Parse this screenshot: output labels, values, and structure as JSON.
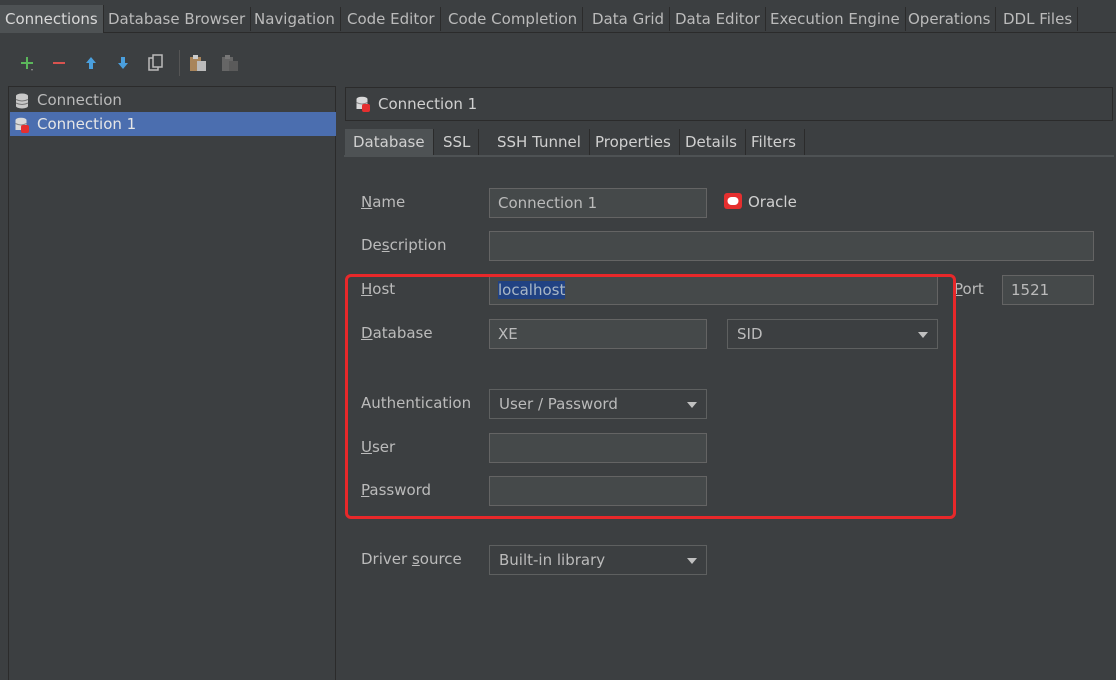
{
  "top_tabs": [
    {
      "label": "Connections",
      "active": true
    },
    {
      "label": "Database Browser"
    },
    {
      "label": "Navigation"
    },
    {
      "label": "Code Editor"
    },
    {
      "label": "Code Completion"
    },
    {
      "label": "Data Grid"
    },
    {
      "label": "Data Editor"
    },
    {
      "label": "Execution Engine"
    },
    {
      "label": "Operations"
    },
    {
      "label": "DDL Files"
    }
  ],
  "toolbar": {
    "icons": [
      "add-icon",
      "remove-icon",
      "move-up-icon",
      "move-down-icon",
      "copy-icon",
      "paste-icon",
      "paste-disabled-icon"
    ]
  },
  "tree": {
    "items": [
      {
        "label": "Connection",
        "icon": "database-icon"
      },
      {
        "label": "Connection 1",
        "icon": "oracle-connection-icon",
        "selected": true
      }
    ]
  },
  "panel": {
    "title": "Connection 1",
    "tabs": [
      "Database",
      "SSL",
      "SSH Tunnel",
      "Properties",
      "Details",
      "Filters"
    ],
    "active_tab": "Database"
  },
  "form": {
    "name_label_u": "N",
    "name_label_rest": "ame",
    "name_value": "Connection 1",
    "db_type": "Oracle",
    "description_label_a": "De",
    "description_label_u": "s",
    "description_label_b": "cription",
    "description_value": "",
    "host_label_u": "H",
    "host_label_rest": "ost",
    "host_value": "localhost",
    "port_label_u": "P",
    "port_label_rest": "ort",
    "port_value": "1521",
    "database_label_u": "D",
    "database_label_rest": "atabase",
    "database_value": "XE",
    "database_type": "SID",
    "auth_label": "Authentication",
    "auth_value": "User / Password",
    "user_label_u": "U",
    "user_label_rest": "ser",
    "user_value": "",
    "password_label_u": "P",
    "password_label_rest": "assword",
    "password_value": "",
    "driver_label_a": "Driver ",
    "driver_label_u": "s",
    "driver_label_b": "ource",
    "driver_value": "Built-in library"
  },
  "colors": {
    "background": "#3c3f41",
    "selection": "#4b6eaf",
    "highlight_box": "#e8282a",
    "oracle_red": "#e52f2f",
    "add_green": "#5bb65b",
    "remove_red": "#d9534f",
    "arrow_blue": "#4a9fdd"
  }
}
